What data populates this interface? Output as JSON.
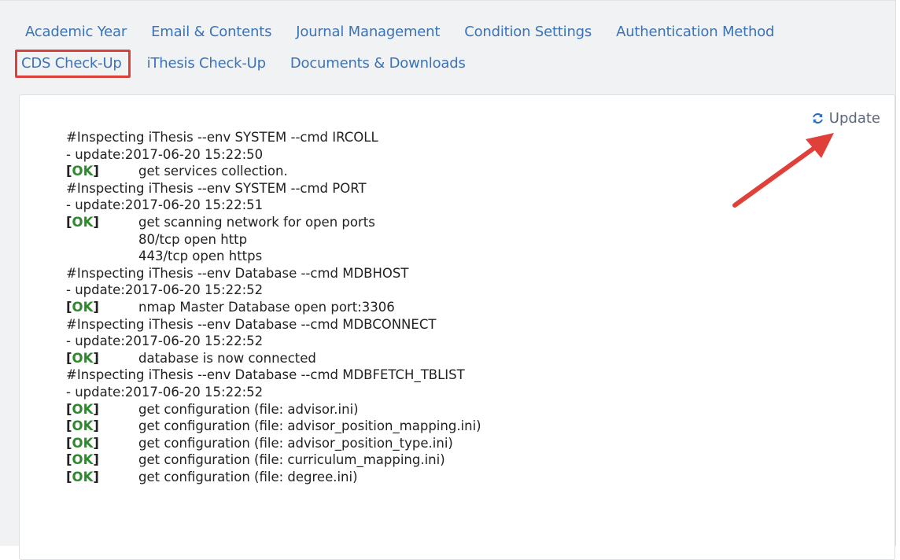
{
  "tabs": [
    {
      "label": "Academic Year",
      "active": false
    },
    {
      "label": "Email & Contents",
      "active": false
    },
    {
      "label": "Journal Management",
      "active": false
    },
    {
      "label": "Condition Settings",
      "active": false
    },
    {
      "label": "Authentication Method",
      "active": false
    },
    {
      "label": "CDS Check-Up",
      "active": true
    },
    {
      "label": "iThesis Check-Up",
      "active": false
    },
    {
      "label": "Documents & Downloads",
      "active": false
    }
  ],
  "update_button": {
    "label": "Update",
    "icon": "refresh-icon"
  },
  "ok_label": "OK",
  "log": [
    {
      "type": "header",
      "text": "#Inspecting iThesis --env SYSTEM --cmd IRCOLL"
    },
    {
      "type": "header",
      "text": "- update:2017-06-20 15:22:50"
    },
    {
      "type": "ok",
      "text": "get services collection."
    },
    {
      "type": "header",
      "text": "#Inspecting iThesis --env SYSTEM --cmd PORT"
    },
    {
      "type": "header",
      "text": "- update:2017-06-20 15:22:51"
    },
    {
      "type": "ok",
      "text": "get scanning network for open ports"
    },
    {
      "type": "indent",
      "text": "80/tcp open http"
    },
    {
      "type": "indent",
      "text": "443/tcp open https"
    },
    {
      "type": "header",
      "text": "#Inspecting iThesis --env Database --cmd MDBHOST"
    },
    {
      "type": "header",
      "text": "- update:2017-06-20 15:22:52"
    },
    {
      "type": "ok",
      "text": "nmap Master Database open port:3306"
    },
    {
      "type": "header",
      "text": "#Inspecting iThesis --env Database --cmd MDBCONNECT"
    },
    {
      "type": "header",
      "text": "- update:2017-06-20 15:22:52"
    },
    {
      "type": "ok",
      "text": "database is now connected"
    },
    {
      "type": "header",
      "text": "#Inspecting iThesis --env Database --cmd MDBFETCH_TBLIST"
    },
    {
      "type": "header",
      "text": "- update:2017-06-20 15:22:52"
    },
    {
      "type": "ok",
      "text": "get configuration (file: advisor.ini)"
    },
    {
      "type": "ok",
      "text": "get configuration (file: advisor_position_mapping.ini)"
    },
    {
      "type": "ok",
      "text": "get configuration (file: advisor_position_type.ini)"
    },
    {
      "type": "ok",
      "text": "get configuration (file: curriculum_mapping.ini)"
    },
    {
      "type": "ok",
      "text": "get configuration (file: degree.ini)"
    }
  ],
  "colors": {
    "tab_link": "#3a73b8",
    "active_highlight": "#d9413a",
    "ok_green": "#2d8a2d",
    "arrow": "#e0403a"
  }
}
